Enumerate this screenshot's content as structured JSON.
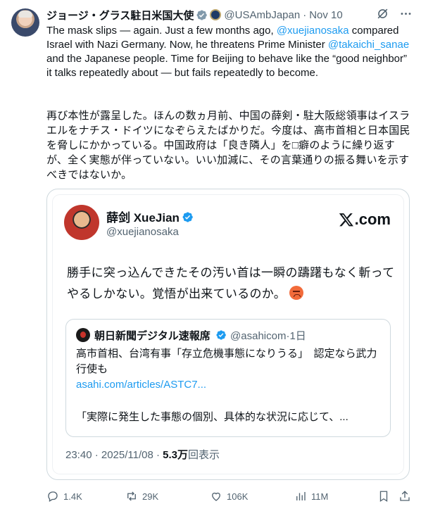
{
  "post": {
    "author_name": "ジョージ・グラス駐日米国大使",
    "handle": "@USAmbJapan",
    "separator": "·",
    "date": "Nov 10",
    "text_en": {
      "p1": "The mask slips — again. Just a few months ago, ",
      "mention1": "@xuejianosaka",
      "p2": " compared Israel with Nazi Germany. Now, he threatens Prime Minister ",
      "mention2": "@takaichi_sanae",
      "p3": " and the Japanese people. Time for Beijing to behave like the “good neighbor” it talks repeatedly about — but fails repeatedly to become."
    },
    "text_jp": "再び本性が露呈した。ほんの数ヵ月前、中国の薛剣・駐大阪総領事はイスラエルをナチス・ドイツになぞらえたばかりだ。今度は、高市首相と日本国民を脅しにかかっている。中国政府は「良き隣人」を□癖のように繰り返すが、全く実態が伴っていない。いい加減に、その言葉通りの振る舞いを示すべきではないか。"
  },
  "quoted": {
    "name": "薛剑 XueJian",
    "handle": "@xuejianosaka",
    "brand_suffix": ".com",
    "text": "勝手に突っ込んできたその汚い首は一瞬の躊躇もなく斬ってやるしかない。覚悟が出来ているのか。",
    "footer_time": "23:40 · 2025/11/08 · ",
    "footer_views": "5.3万",
    "footer_views_label": "回表示"
  },
  "nested": {
    "name": "朝日新聞デジタル速報席",
    "handle": "@asahicom·1日",
    "text": "高市首相、台湾有事「存立危機事態になりうる」　認定なら武力行使も",
    "link": "asahi.com/articles/ASTC7...",
    "quote": "「実際に発生した事態の個別、具体的な状況に応じて、..."
  },
  "actions": {
    "replies": "1.4K",
    "reposts": "29K",
    "likes": "106K",
    "views": "11M"
  },
  "colors": {
    "link": "#1d9bf0",
    "secondary": "#536471",
    "border": "#cfd9de"
  }
}
